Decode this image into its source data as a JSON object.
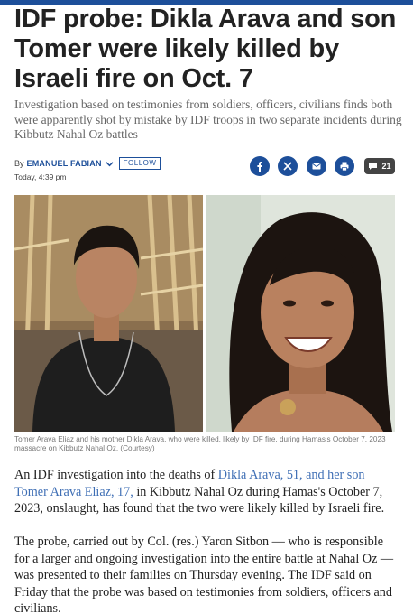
{
  "article": {
    "headline": "IDF probe: Dikla Arava and son Tomer were likely killed by Israeli fire on Oct. 7",
    "subhead": "Investigation based on testimonies from soldiers, officers, civilians finds both were apparently shot by mistake by IDF troops in two separate incidents during Kibbutz Nahal Oz battles"
  },
  "byline": {
    "prefix": "By",
    "author": "EMANUEL FABIAN",
    "follow_label": "FOLLOW",
    "timestamp": "Today, 4:39 pm"
  },
  "share": {
    "icons": [
      "facebook-icon",
      "x-icon",
      "email-icon",
      "print-icon",
      "comment-icon"
    ],
    "comment_count": "21",
    "brand_color": "#1d4f9a"
  },
  "photo": {
    "caption": "Tomer Arava Eliaz and his mother Dikla Arava, who were killed, likely by IDF fire, during Hamas's October 7, 2023 massacre on Kibbutz Nahal Oz. (Courtesy)"
  },
  "body": {
    "p1_before": "An IDF investigation into the deaths of ",
    "p1_link": "Dikla Arava, 51, and her son Tomer Arava Eliaz, 17,",
    "p1_after": " in Kibbutz Nahal Oz during Hamas's October 7, 2023, onslaught, has found that the two were likely killed by Israeli fire.",
    "p2": "The probe, carried out by Col. (res.) Yaron Sitbon — who is responsible for a larger and ongoing investigation into the entire battle at Nahal Oz — was presented to their families on Thursday evening. The IDF said on Friday that the probe was based on testimonies from soldiers, officers and civilians."
  }
}
